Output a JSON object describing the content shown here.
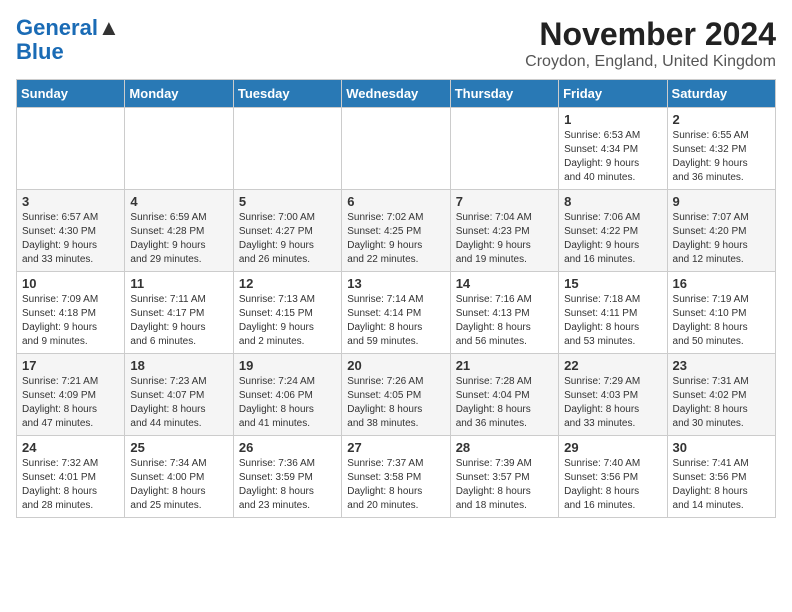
{
  "logo": {
    "line1": "General",
    "line2": "Blue"
  },
  "title": "November 2024",
  "subtitle": "Croydon, England, United Kingdom",
  "days_of_week": [
    "Sunday",
    "Monday",
    "Tuesday",
    "Wednesday",
    "Thursday",
    "Friday",
    "Saturday"
  ],
  "weeks": [
    [
      {
        "day": "",
        "info": ""
      },
      {
        "day": "",
        "info": ""
      },
      {
        "day": "",
        "info": ""
      },
      {
        "day": "",
        "info": ""
      },
      {
        "day": "",
        "info": ""
      },
      {
        "day": "1",
        "info": "Sunrise: 6:53 AM\nSunset: 4:34 PM\nDaylight: 9 hours\nand 40 minutes."
      },
      {
        "day": "2",
        "info": "Sunrise: 6:55 AM\nSunset: 4:32 PM\nDaylight: 9 hours\nand 36 minutes."
      }
    ],
    [
      {
        "day": "3",
        "info": "Sunrise: 6:57 AM\nSunset: 4:30 PM\nDaylight: 9 hours\nand 33 minutes."
      },
      {
        "day": "4",
        "info": "Sunrise: 6:59 AM\nSunset: 4:28 PM\nDaylight: 9 hours\nand 29 minutes."
      },
      {
        "day": "5",
        "info": "Sunrise: 7:00 AM\nSunset: 4:27 PM\nDaylight: 9 hours\nand 26 minutes."
      },
      {
        "day": "6",
        "info": "Sunrise: 7:02 AM\nSunset: 4:25 PM\nDaylight: 9 hours\nand 22 minutes."
      },
      {
        "day": "7",
        "info": "Sunrise: 7:04 AM\nSunset: 4:23 PM\nDaylight: 9 hours\nand 19 minutes."
      },
      {
        "day": "8",
        "info": "Sunrise: 7:06 AM\nSunset: 4:22 PM\nDaylight: 9 hours\nand 16 minutes."
      },
      {
        "day": "9",
        "info": "Sunrise: 7:07 AM\nSunset: 4:20 PM\nDaylight: 9 hours\nand 12 minutes."
      }
    ],
    [
      {
        "day": "10",
        "info": "Sunrise: 7:09 AM\nSunset: 4:18 PM\nDaylight: 9 hours\nand 9 minutes."
      },
      {
        "day": "11",
        "info": "Sunrise: 7:11 AM\nSunset: 4:17 PM\nDaylight: 9 hours\nand 6 minutes."
      },
      {
        "day": "12",
        "info": "Sunrise: 7:13 AM\nSunset: 4:15 PM\nDaylight: 9 hours\nand 2 minutes."
      },
      {
        "day": "13",
        "info": "Sunrise: 7:14 AM\nSunset: 4:14 PM\nDaylight: 8 hours\nand 59 minutes."
      },
      {
        "day": "14",
        "info": "Sunrise: 7:16 AM\nSunset: 4:13 PM\nDaylight: 8 hours\nand 56 minutes."
      },
      {
        "day": "15",
        "info": "Sunrise: 7:18 AM\nSunset: 4:11 PM\nDaylight: 8 hours\nand 53 minutes."
      },
      {
        "day": "16",
        "info": "Sunrise: 7:19 AM\nSunset: 4:10 PM\nDaylight: 8 hours\nand 50 minutes."
      }
    ],
    [
      {
        "day": "17",
        "info": "Sunrise: 7:21 AM\nSunset: 4:09 PM\nDaylight: 8 hours\nand 47 minutes."
      },
      {
        "day": "18",
        "info": "Sunrise: 7:23 AM\nSunset: 4:07 PM\nDaylight: 8 hours\nand 44 minutes."
      },
      {
        "day": "19",
        "info": "Sunrise: 7:24 AM\nSunset: 4:06 PM\nDaylight: 8 hours\nand 41 minutes."
      },
      {
        "day": "20",
        "info": "Sunrise: 7:26 AM\nSunset: 4:05 PM\nDaylight: 8 hours\nand 38 minutes."
      },
      {
        "day": "21",
        "info": "Sunrise: 7:28 AM\nSunset: 4:04 PM\nDaylight: 8 hours\nand 36 minutes."
      },
      {
        "day": "22",
        "info": "Sunrise: 7:29 AM\nSunset: 4:03 PM\nDaylight: 8 hours\nand 33 minutes."
      },
      {
        "day": "23",
        "info": "Sunrise: 7:31 AM\nSunset: 4:02 PM\nDaylight: 8 hours\nand 30 minutes."
      }
    ],
    [
      {
        "day": "24",
        "info": "Sunrise: 7:32 AM\nSunset: 4:01 PM\nDaylight: 8 hours\nand 28 minutes."
      },
      {
        "day": "25",
        "info": "Sunrise: 7:34 AM\nSunset: 4:00 PM\nDaylight: 8 hours\nand 25 minutes."
      },
      {
        "day": "26",
        "info": "Sunrise: 7:36 AM\nSunset: 3:59 PM\nDaylight: 8 hours\nand 23 minutes."
      },
      {
        "day": "27",
        "info": "Sunrise: 7:37 AM\nSunset: 3:58 PM\nDaylight: 8 hours\nand 20 minutes."
      },
      {
        "day": "28",
        "info": "Sunrise: 7:39 AM\nSunset: 3:57 PM\nDaylight: 8 hours\nand 18 minutes."
      },
      {
        "day": "29",
        "info": "Sunrise: 7:40 AM\nSunset: 3:56 PM\nDaylight: 8 hours\nand 16 minutes."
      },
      {
        "day": "30",
        "info": "Sunrise: 7:41 AM\nSunset: 3:56 PM\nDaylight: 8 hours\nand 14 minutes."
      }
    ]
  ]
}
